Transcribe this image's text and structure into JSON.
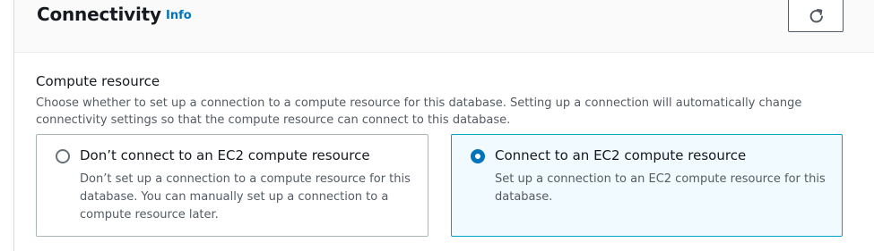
{
  "header": {
    "title": "Connectivity",
    "info_label": "Info",
    "refresh_icon": "refresh-icon"
  },
  "compute_resource": {
    "label": "Compute resource",
    "description": "Choose whether to set up a connection to a compute resource for this database. Setting up a connection will automatically change connectivity settings so that the compute resource can connect to this database.",
    "options": [
      {
        "title": "Don’t connect to an EC2 compute resource",
        "description": "Don’t set up a connection to a compute resource for this database. You can manually set up a connection to a compute resource later.",
        "selected": false
      },
      {
        "title": "Connect to an EC2 compute resource",
        "description": "Set up a connection to an EC2 compute resource for this database.",
        "selected": true
      }
    ]
  },
  "colors": {
    "accent": "#0073bb",
    "selected_border": "#00a1c9",
    "selected_background": "#f1faff",
    "text_primary": "#16191f",
    "text_secondary": "#545b64"
  }
}
